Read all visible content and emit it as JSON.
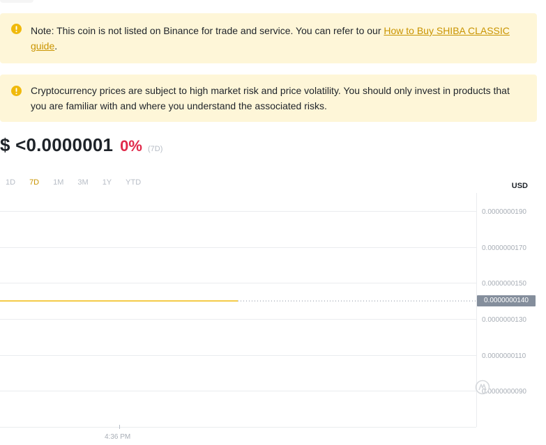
{
  "notices": [
    {
      "text_before": "Note: This coin is not listed on Binance for trade and service. You can refer to our ",
      "link_text": "How to Buy SHIBA CLASSIC guide",
      "text_after": "."
    },
    {
      "text": "Cryptocurrency prices are subject to high market risk and price volatility. You should only invest in products that you are familiar with and where you understand the associated risks."
    }
  ],
  "price": {
    "value": "$ <0.0000001",
    "change": "0%",
    "period": "(7D)"
  },
  "range_tabs": [
    "1D",
    "7D",
    "1M",
    "3M",
    "1Y",
    "YTD"
  ],
  "active_range": "7D",
  "currency": "USD",
  "colors": {
    "accent": "#c99400",
    "line": "#f0b90b",
    "negative": "#e0294a",
    "notice_bg": "#fef6d8"
  },
  "chart_data": {
    "type": "line",
    "title": "",
    "xlabel": "",
    "ylabel": "",
    "y_ticks": [
      "0.0000000190",
      "0.0000000170",
      "0.0000000150",
      "0.0000000130",
      "0.0000000110",
      "0.0000000090"
    ],
    "y_tick_values": [
      1.9e-08,
      1.7e-08,
      1.5e-08,
      1.3e-08,
      1.1e-08,
      9e-09
    ],
    "ylim": [
      7e-09,
      2e-08
    ],
    "x_tick": "4:36 PM",
    "series": [
      {
        "values": [
          1.4e-08,
          1.4e-08,
          1.4e-08,
          1.4e-08,
          1.4e-08,
          1.4e-08,
          1.4e-08
        ]
      }
    ],
    "current_value": 1.4e-08,
    "current_label": "0.0000000140",
    "grid": true
  }
}
